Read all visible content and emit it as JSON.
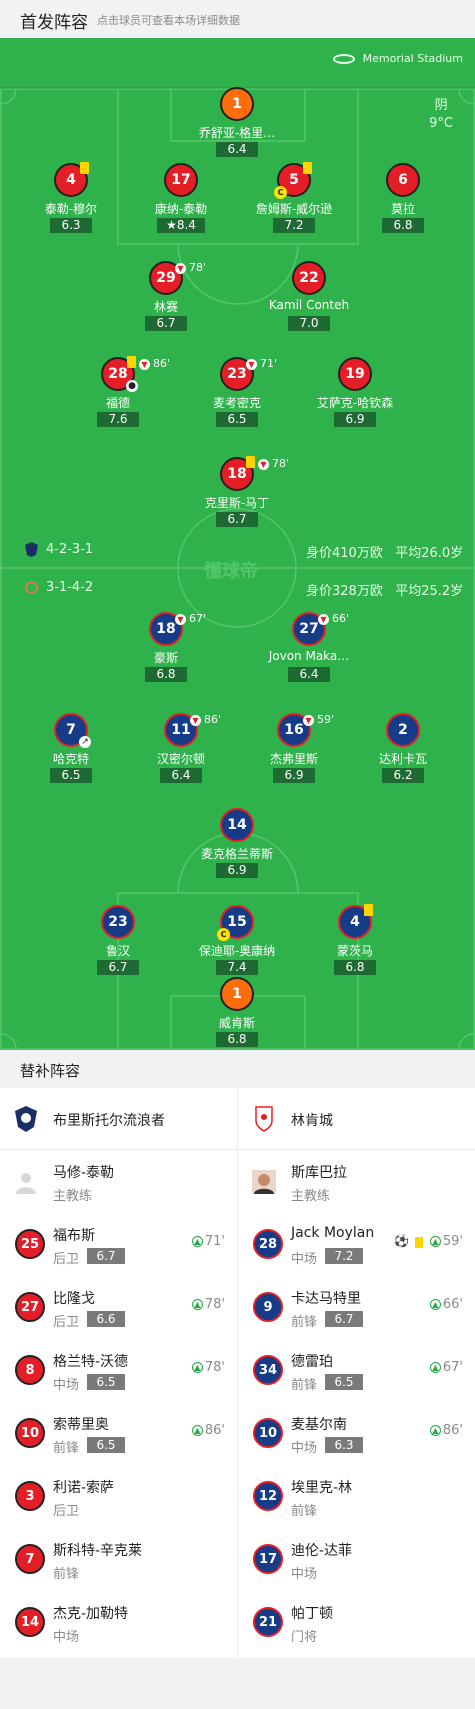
{
  "header": {
    "title": "首发阵容",
    "subtitle": "点击球员可查看本场详细数据"
  },
  "pitch": {
    "stadium": "Memorial Stadium",
    "weather": "阴",
    "temp": "9°C",
    "watermark": "懂球帝"
  },
  "home": {
    "formation": "4-2-3-1",
    "value": "身价410万欧",
    "avg_age": "平均26.0岁"
  },
  "away": {
    "formation": "3-1-4-2",
    "value": "身价328万欧",
    "avg_age": "平均25.2岁"
  },
  "players": [
    {
      "no": "1",
      "name": "乔舒亚-格里…",
      "rating": "6.4"
    },
    {
      "no": "4",
      "name": "泰勒-穆尔",
      "rating": "6.3"
    },
    {
      "no": "17",
      "name": "康纳-泰勒",
      "rating": "8.4"
    },
    {
      "no": "5",
      "name": "詹姆斯-威尔逊",
      "rating": "7.2"
    },
    {
      "no": "6",
      "name": "莫拉",
      "rating": "6.8"
    },
    {
      "no": "29",
      "name": "林赛",
      "rating": "6.7",
      "sub": "78'"
    },
    {
      "no": "22",
      "name": "Kamil Conteh",
      "rating": "7.0"
    },
    {
      "no": "28",
      "name": "福德",
      "rating": "7.6",
      "sub": "86'"
    },
    {
      "no": "23",
      "name": "麦考密克",
      "rating": "6.5",
      "sub": "71'"
    },
    {
      "no": "19",
      "name": "艾萨克-哈钦森",
      "rating": "6.9"
    },
    {
      "no": "18",
      "name": "克里斯-马丁",
      "rating": "6.7",
      "sub": "78'"
    },
    {
      "no": "18",
      "name": "豪斯",
      "rating": "6.8",
      "sub": "67'"
    },
    {
      "no": "27",
      "name": "Jovon Maka…",
      "rating": "6.4",
      "sub": "66'"
    },
    {
      "no": "7",
      "name": "哈克特",
      "rating": "6.5"
    },
    {
      "no": "11",
      "name": "汉密尔顿",
      "rating": "6.4",
      "sub": "86'"
    },
    {
      "no": "16",
      "name": "杰弗里斯",
      "rating": "6.9",
      "sub": "59'"
    },
    {
      "no": "2",
      "name": "达利卡瓦",
      "rating": "6.2"
    },
    {
      "no": "14",
      "name": "麦克格兰蒂斯",
      "rating": "6.9"
    },
    {
      "no": "23",
      "name": "鲁汉",
      "rating": "6.7"
    },
    {
      "no": "15",
      "name": "保迪耶-奥康纳",
      "rating": "7.4"
    },
    {
      "no": "4",
      "name": "蒙茨马",
      "rating": "6.8"
    },
    {
      "no": "1",
      "name": "威肯斯",
      "rating": "6.8"
    }
  ],
  "subs": {
    "title": "替补阵容",
    "home_team": "布里斯托尔流浪者",
    "away_team": "林肯城",
    "home_coach": {
      "name": "马修-泰勒",
      "role": "主教练"
    },
    "away_coach": {
      "name": "斯库巴拉",
      "role": "主教练"
    },
    "home": [
      {
        "no": "25",
        "name": "福布斯",
        "pos": "后卫",
        "rating": "6.7",
        "in": "71'"
      },
      {
        "no": "27",
        "name": "比隆戈",
        "pos": "后卫",
        "rating": "6.6",
        "in": "78'"
      },
      {
        "no": "8",
        "name": "格兰特-沃德",
        "pos": "中场",
        "rating": "6.5",
        "in": "78'"
      },
      {
        "no": "10",
        "name": "索蒂里奥",
        "pos": "前锋",
        "rating": "6.5",
        "in": "86'"
      },
      {
        "no": "3",
        "name": "利诺-索萨",
        "pos": "后卫"
      },
      {
        "no": "7",
        "name": "斯科特-辛克莱",
        "pos": "前锋"
      },
      {
        "no": "14",
        "name": "杰克-加勒特",
        "pos": "中场"
      }
    ],
    "away": [
      {
        "no": "28",
        "name": "Jack Moylan",
        "pos": "中场",
        "rating": "7.2",
        "in": "59'"
      },
      {
        "no": "9",
        "name": "卡达马特里",
        "pos": "前锋",
        "rating": "6.7",
        "in": "66'"
      },
      {
        "no": "34",
        "name": "德雷珀",
        "pos": "前锋",
        "rating": "6.5",
        "in": "67'"
      },
      {
        "no": "10",
        "name": "麦基尔南",
        "pos": "中场",
        "rating": "6.3",
        "in": "86'"
      },
      {
        "no": "12",
        "name": "埃里克-林",
        "pos": "前锋"
      },
      {
        "no": "17",
        "name": "迪伦-达菲",
        "pos": "中场"
      },
      {
        "no": "21",
        "name": "帕丁顿",
        "pos": "门将"
      }
    ]
  }
}
